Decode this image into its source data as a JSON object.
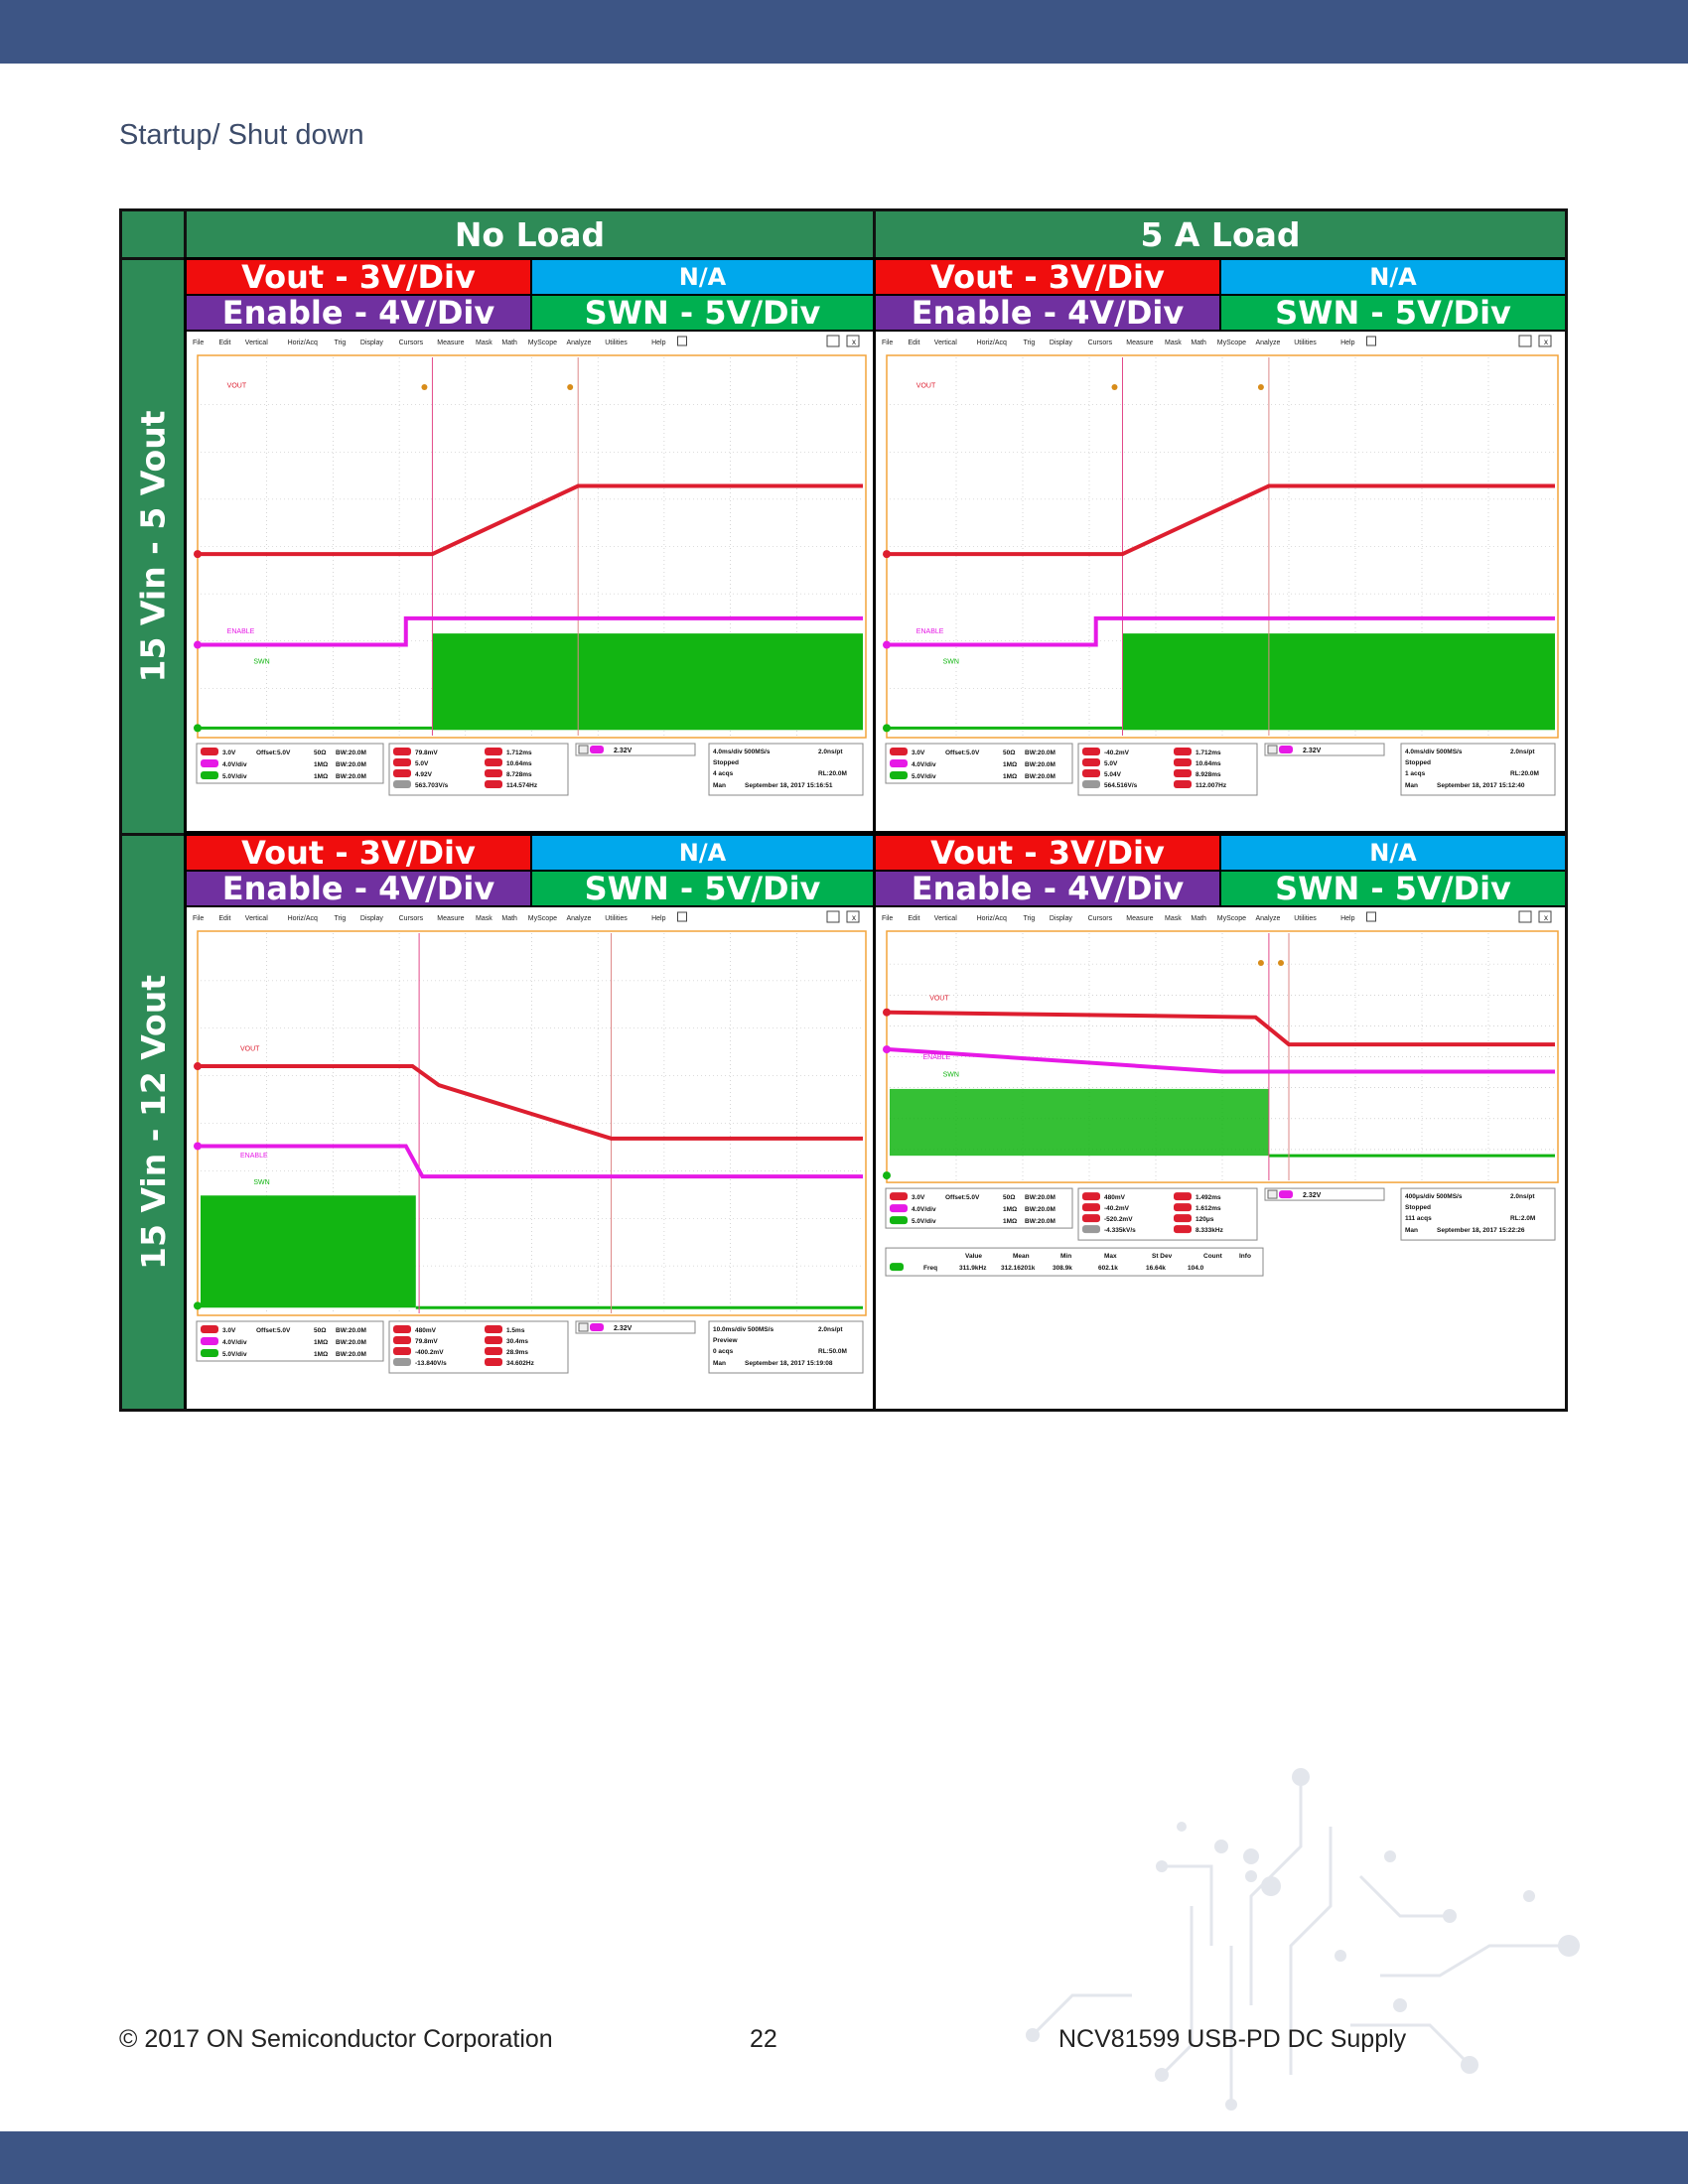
{
  "page": {
    "heading": "Startup/ Shut down",
    "footer_left": "© 2017 ON Semiconductor Corporation",
    "footer_center": "22",
    "footer_right": "NCV81599 USB-PD DC Supply"
  },
  "table": {
    "col_headers": [
      "No Load",
      "5 A Load"
    ],
    "row_headers": [
      "15 Vin - 5 Vout",
      "15 Vin - 12 Vout"
    ],
    "channel_labels": {
      "vout": "Vout - 3V/Div",
      "na": "N/A",
      "enable": "Enable - 4V/Div",
      "swn": "SWN - 5V/Div"
    }
  },
  "colors": {
    "vout": "#dd1e2f",
    "enable": "#e619e6",
    "swn": "#12b512",
    "header_green": "#2e8b57",
    "band": "#3d5585"
  },
  "scope_menu": [
    "File",
    "Edit",
    "Vertical",
    "Horiz/Acq",
    "Trig",
    "Display",
    "Cursors",
    "Measure",
    "Mask",
    "Math",
    "MyScope",
    "Analyze",
    "Utilities",
    "Help"
  ],
  "scopes": [
    {
      "trace_labels": [
        "VOUT",
        "ENABLE",
        "SWN"
      ],
      "channels": [
        {
          "ch": "C1",
          "scale": "3.0V",
          "offset": "Offset:5.0V",
          "imp": "50Ω",
          "bw": "BW:20.0M"
        },
        {
          "ch": "C3",
          "scale": "4.0V/div",
          "offset": "",
          "imp": "1MΩ",
          "bw": "BW:20.0M"
        },
        {
          "ch": "C4",
          "scale": "5.0V/div",
          "offset": "",
          "imp": "1MΩ",
          "bw": "BW:20.0M"
        }
      ],
      "measurements": [
        [
          "79.8mV",
          "1.712ms"
        ],
        [
          "5.0V",
          "10.64ms"
        ],
        [
          "4.92V",
          "8.728ms"
        ],
        [
          "563.703V/s",
          "114.574Hz"
        ]
      ],
      "trigger": "2.32V",
      "acq": [
        "4.0ms/div  500MS/s",
        "2.0ns/pt",
        "Stopped",
        "4 acqs",
        "RL:20.0M",
        "Man",
        "September 18, 2017  15:16:51"
      ]
    },
    {
      "trace_labels": [
        "VOUT",
        "ENABLE",
        "SWN"
      ],
      "channels": [
        {
          "ch": "C1",
          "scale": "3.0V",
          "offset": "Offset:5.0V",
          "imp": "50Ω",
          "bw": "BW:20.0M"
        },
        {
          "ch": "C3",
          "scale": "4.0V/div",
          "offset": "",
          "imp": "1MΩ",
          "bw": "BW:20.0M"
        },
        {
          "ch": "C4",
          "scale": "5.0V/div",
          "offset": "",
          "imp": "1MΩ",
          "bw": "BW:20.0M"
        }
      ],
      "measurements": [
        [
          "-40.2mV",
          "1.712ms"
        ],
        [
          "5.0V",
          "10.64ms"
        ],
        [
          "5.04V",
          "8.928ms"
        ],
        [
          "564.516V/s",
          "112.007Hz"
        ]
      ],
      "trigger": "2.32V",
      "acq": [
        "4.0ms/div  500MS/s",
        "2.0ns/pt",
        "Stopped",
        "1 acqs",
        "RL:20.0M",
        "Man",
        "September 18, 2017  15:12:40"
      ]
    },
    {
      "trace_labels": [
        "VOUT",
        "ENABLE",
        "SWN"
      ],
      "channels": [
        {
          "ch": "C1",
          "scale": "3.0V",
          "offset": "Offset:5.0V",
          "imp": "50Ω",
          "bw": "BW:20.0M"
        },
        {
          "ch": "C3",
          "scale": "4.0V/div",
          "offset": "",
          "imp": "1MΩ",
          "bw": "BW:20.0M"
        },
        {
          "ch": "C4",
          "scale": "5.0V/div",
          "offset": "",
          "imp": "1MΩ",
          "bw": "BW:20.0M"
        }
      ],
      "measurements": [
        [
          "480mV",
          "1.5ms"
        ],
        [
          "79.8mV",
          "30.4ms"
        ],
        [
          "-400.2mV",
          "28.9ms"
        ],
        [
          "-13.840V/s",
          "34.602Hz"
        ]
      ],
      "trigger": "2.32V",
      "acq": [
        "10.0ms/div 500MS/s",
        "2.0ns/pt",
        "Preview",
        "0 acqs",
        "RL:50.0M",
        "Man",
        "September 18, 2017  15:19:08"
      ]
    },
    {
      "trace_labels": [
        "VOUT",
        "ENABLE",
        "SWN"
      ],
      "channels": [
        {
          "ch": "C1",
          "scale": "3.0V",
          "offset": "Offset:5.0V",
          "imp": "50Ω",
          "bw": "BW:20.0M"
        },
        {
          "ch": "C3",
          "scale": "4.0V/div",
          "offset": "",
          "imp": "1MΩ",
          "bw": "BW:20.0M"
        },
        {
          "ch": "C4",
          "scale": "5.0V/div",
          "offset": "",
          "imp": "1MΩ",
          "bw": "BW:20.0M"
        }
      ],
      "measurements": [
        [
          "480mV",
          "1.492ms"
        ],
        [
          "-40.2mV",
          "1.612ms"
        ],
        [
          "-520.2mV",
          "120μs"
        ],
        [
          "-4.335kV/s",
          "8.333kHz"
        ]
      ],
      "trigger": "2.32V",
      "acq": [
        "400μs/div  500MS/s",
        "2.0ns/pt",
        "Stopped",
        "111 acqs",
        "RL:2.0M",
        "Man",
        "September 18, 2017  15:22:26"
      ],
      "stats_header": [
        "Value",
        "Mean",
        "Min",
        "Max",
        "St Dev",
        "Count",
        "Info"
      ],
      "stats_row": [
        "Freq",
        "311.9kHz",
        "312.16201k",
        "308.9k",
        "602.1k",
        "16.64k",
        "104.0"
      ]
    }
  ]
}
